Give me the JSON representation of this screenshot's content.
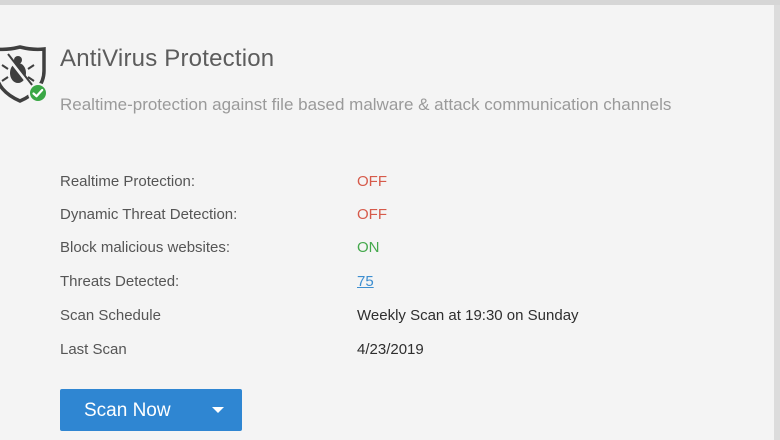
{
  "header": {
    "title": "AntiVirus Protection",
    "subtitle": "Realtime-protection against file based malware & attack communication channels"
  },
  "status_rows": [
    {
      "label": "Realtime Protection:",
      "value": "OFF",
      "state": "off"
    },
    {
      "label": "Dynamic Threat Detection:",
      "value": "OFF",
      "state": "off"
    },
    {
      "label": "Block malicious websites:",
      "value": "ON",
      "state": "on"
    },
    {
      "label": "Threats Detected:",
      "value": "75",
      "state": "link"
    },
    {
      "label": "Scan Schedule",
      "value": "Weekly Scan at 19:30 on Sunday",
      "state": "text"
    },
    {
      "label": "Last Scan",
      "value": "4/23/2019",
      "state": "text"
    }
  ],
  "actions": {
    "scan_now_label": "Scan Now"
  },
  "icons": {
    "shield": "shield-bug-icon",
    "status": "check-circle-icon",
    "dropdown": "caret-down-icon"
  },
  "colors": {
    "off": "#d65a4a",
    "on": "#44a84c",
    "link": "#3d8ed0",
    "button": "#2f86d2",
    "check": "#3aa745"
  }
}
